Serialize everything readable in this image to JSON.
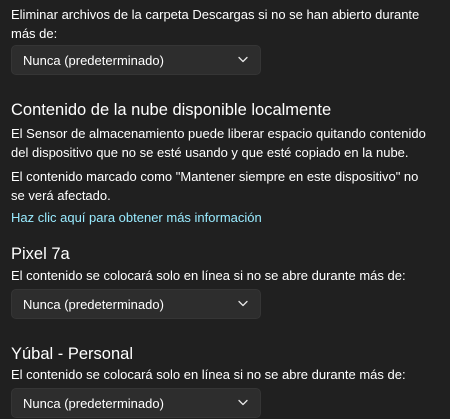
{
  "downloads": {
    "description": "Eliminar archivos de la carpeta Descargas si no se han abierto durante más de:",
    "description_line1": "Eliminar archivos de la carpeta Descargas si no se han abierto durante",
    "description_line2": "más de:",
    "dropdown_value": "Nunca (predeterminado)"
  },
  "cloud": {
    "title": "Contenido de la nube disponible localmente",
    "para1_line1": "El Sensor de almacenamiento puede liberar espacio quitando contenido",
    "para1_line2": "del dispositivo que no se esté usando y que esté copiado en la nube.",
    "para2_line1": "El contenido marcado como \"Mantener siempre en este dispositivo\" no",
    "para2_line2": "se verá afectado.",
    "link": "Haz clic aquí para obtener más información"
  },
  "accounts": [
    {
      "name": "Pixel 7a",
      "description": "El contenido se colocará solo en línea si no se abre durante más de:",
      "dropdown_value": "Nunca (predeterminado)"
    },
    {
      "name": "Yúbal - Personal",
      "description": "El contenido se colocará solo en línea si no se abre durante más de:",
      "dropdown_value": "Nunca (predeterminado)"
    }
  ],
  "icons": {
    "dropdown_chevron": "chevron-down-icon"
  },
  "colors": {
    "background": "#202020",
    "dropdown_bg": "#2d2d2d",
    "link": "#99ebff",
    "text": "#ffffff"
  }
}
